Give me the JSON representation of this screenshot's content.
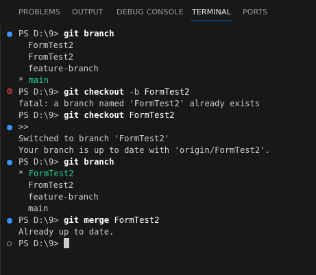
{
  "panel": {
    "tabs": [
      {
        "label": "PROBLEMS"
      },
      {
        "label": "OUTPUT"
      },
      {
        "label": "DEBUG CONSOLE"
      },
      {
        "label": "TERMINAL"
      },
      {
        "label": "PORTS"
      }
    ],
    "active_tab": "TERMINAL"
  },
  "terminal": {
    "prompt": "PS D:\\9>",
    "lines": {
      "l1_cmd": "git branch",
      "l2": "FormTest2",
      "l3": "FromTest2",
      "l4": "feature-branch",
      "l5_star": "*",
      "l5": "main",
      "l6_cmd": "git checkout",
      "l6_flag": "-b",
      "l6_arg": "FormTest2",
      "l7": "fatal: a branch named 'FormTest2' already exists",
      "l8_cmd": "git checkout",
      "l8_arg": "FormTest2",
      "l9": ">>",
      "l10": "Switched to branch 'FormTest2'",
      "l11": "Your branch is up to date with 'origin/FormTest2'.",
      "l12_cmd": "git branch",
      "l13_star": "*",
      "l13": "FormTest2",
      "l14": "FromTest2",
      "l15": "feature-branch",
      "l16": "main",
      "l17_cmd": "git merge",
      "l17_arg": "FormTest2",
      "l18": "Already up to date."
    }
  },
  "colors": {
    "background": "#181818",
    "text": "#cccccc",
    "success_dot": "#3794ff",
    "error_dot": "#f14c4c",
    "current_branch": "#23d18b",
    "active_tab_underline": "#0078d4"
  }
}
